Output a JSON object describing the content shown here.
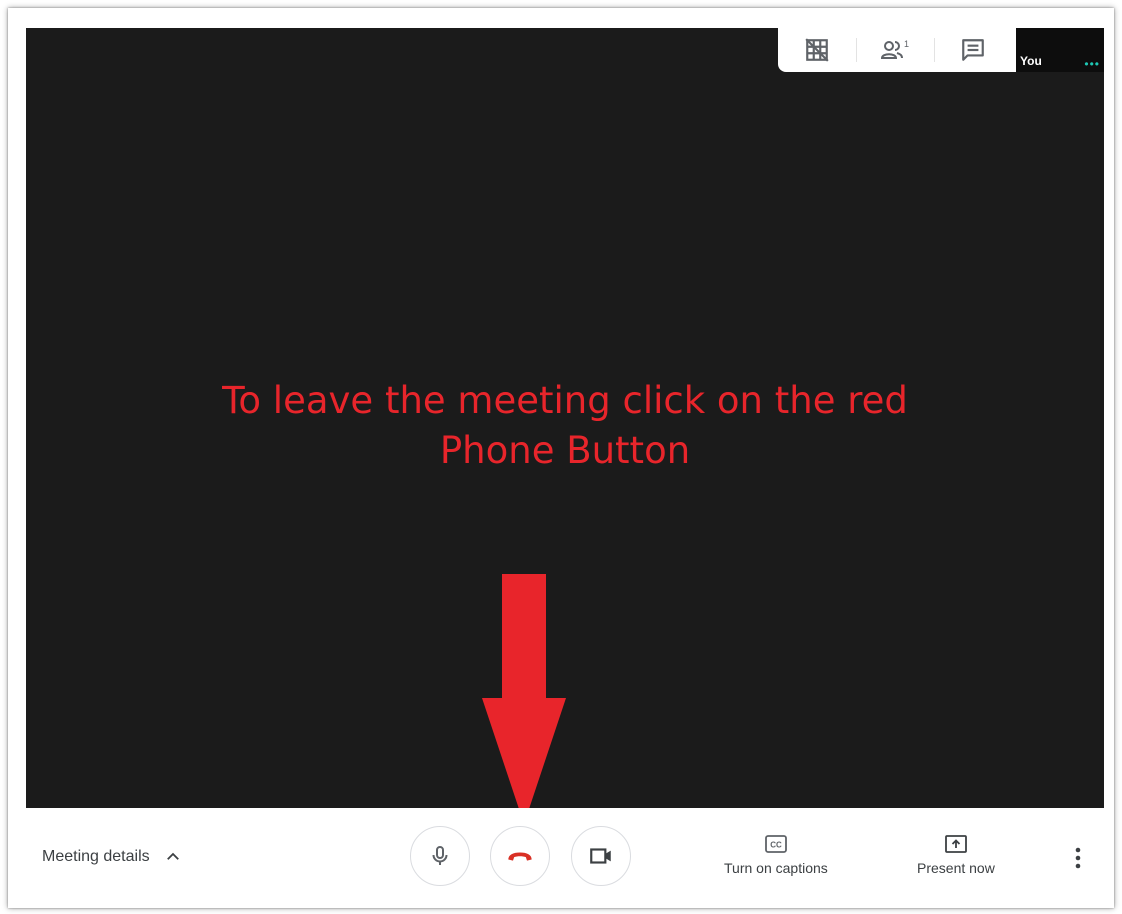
{
  "annotation": {
    "line1": "To leave the meeting click on the red",
    "line2": "Phone Button"
  },
  "top_bar": {
    "icons": [
      "grid-layout-icon",
      "people-icon",
      "chat-icon"
    ],
    "participant_count": "1"
  },
  "self_view": {
    "label": "You",
    "indicator": "•••"
  },
  "controls": {
    "meeting_details_label": "Meeting details",
    "captions_label": "Turn on captions",
    "captions_icon_text": "CC",
    "present_label": "Present now",
    "icons": [
      "microphone-icon",
      "hang-up-phone-icon",
      "camera-icon",
      "more-vertical-icon"
    ]
  },
  "colors": {
    "video_background": "#1b1b1b",
    "annotation_red": "#e8252b",
    "hang_up_red": "#d93025",
    "accent_teal": "#1ec7b4",
    "icon_gray": "#5f6368"
  }
}
